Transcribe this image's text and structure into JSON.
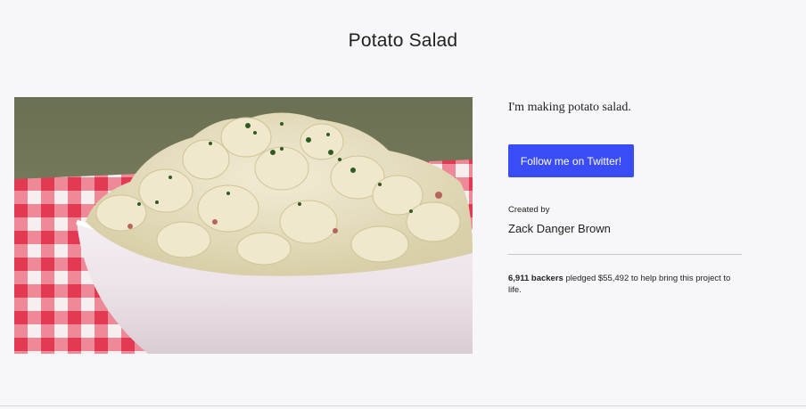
{
  "project": {
    "title": "Potato Salad",
    "blurb": "I'm making potato salad.",
    "hero_image": "potato-salad-in-white-bowl-on-checkered-cloth"
  },
  "cta": {
    "follow_label": "Follow me on Twitter!"
  },
  "creator": {
    "label": "Created by",
    "name": "Zack Danger Brown"
  },
  "stats": {
    "backers": "6,911 backers",
    "pledge_text": " pledged $55,492 to help bring this project to life."
  },
  "colors": {
    "accent": "#3a4cf5",
    "background": "#f7f7f9"
  }
}
